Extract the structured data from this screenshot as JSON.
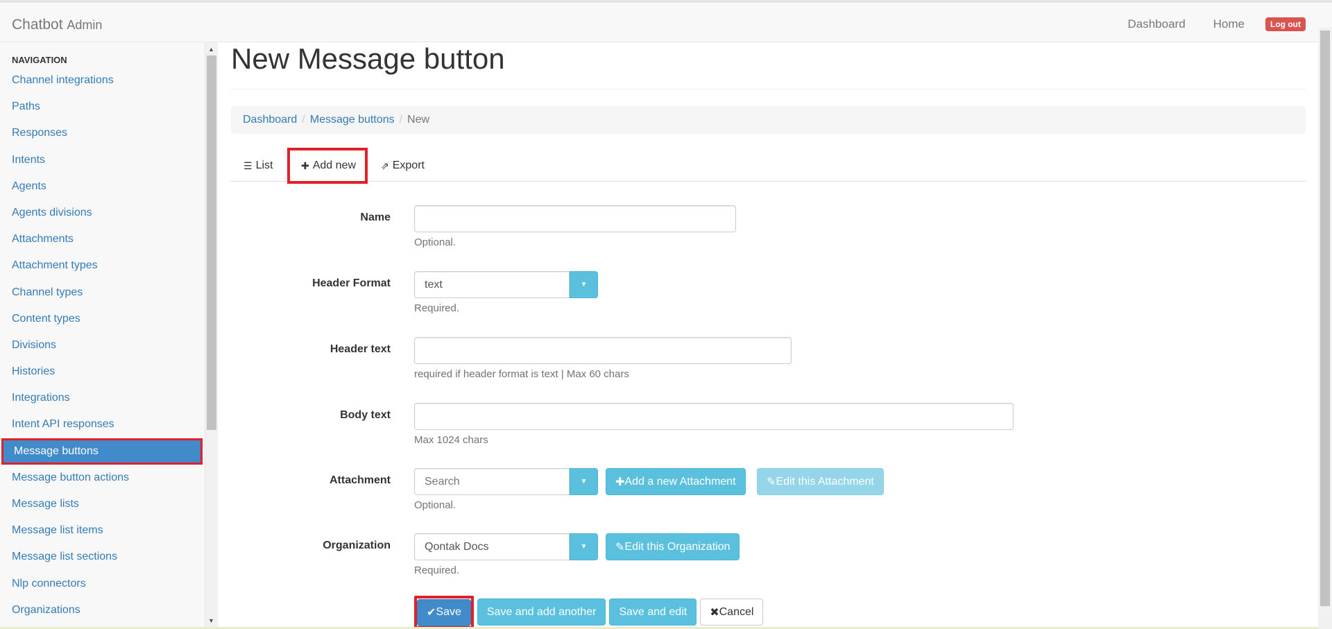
{
  "app": {
    "brand": "Chatbot",
    "brand_sub": "Admin"
  },
  "topnav": {
    "dashboard": "Dashboard",
    "home": "Home",
    "logout": "Log out"
  },
  "sidebar": {
    "header": "NAVIGATION",
    "items": [
      {
        "label": "Channel integrations"
      },
      {
        "label": "Paths"
      },
      {
        "label": "Responses"
      },
      {
        "label": "Intents"
      },
      {
        "label": "Agents"
      },
      {
        "label": "Agents divisions"
      },
      {
        "label": "Attachments"
      },
      {
        "label": "Attachment types"
      },
      {
        "label": "Channel types"
      },
      {
        "label": "Content types"
      },
      {
        "label": "Divisions"
      },
      {
        "label": "Histories"
      },
      {
        "label": "Integrations"
      },
      {
        "label": "Intent API responses"
      },
      {
        "label": "Message buttons"
      },
      {
        "label": "Message button actions"
      },
      {
        "label": "Message lists"
      },
      {
        "label": "Message list items"
      },
      {
        "label": "Message list sections"
      },
      {
        "label": "Nlp connectors"
      },
      {
        "label": "Organizations"
      }
    ],
    "active_index": 14
  },
  "page": {
    "title": "New Message button"
  },
  "breadcrumb": {
    "dashboard": "Dashboard",
    "message_buttons": "Message buttons",
    "current": "New"
  },
  "tabs": {
    "list": "List",
    "add_new": "Add new",
    "export": "Export"
  },
  "form": {
    "name": {
      "label": "Name",
      "value": "",
      "help": "Optional."
    },
    "header_format": {
      "label": "Header Format",
      "value": "text",
      "help": "Required."
    },
    "header_text": {
      "label": "Header text",
      "value": "",
      "help": "required if header format is text | Max 60 chars"
    },
    "body_text": {
      "label": "Body text",
      "value": "",
      "help": "Max 1024 chars"
    },
    "attachment": {
      "label": "Attachment",
      "placeholder": "Search",
      "help": "Optional.",
      "add_label": "Add a new Attachment",
      "edit_label": "Edit this Attachment"
    },
    "organization": {
      "label": "Organization",
      "value": "Qontak Docs",
      "help": "Required.",
      "edit_label": "Edit this Organization"
    }
  },
  "actions": {
    "save": "Save",
    "save_add": "Save and add another",
    "save_edit": "Save and edit",
    "cancel": "Cancel"
  },
  "colors": {
    "primary": "#428bca",
    "info": "#5bc0de",
    "danger": "#d9534f",
    "highlight": "#e0202a"
  }
}
